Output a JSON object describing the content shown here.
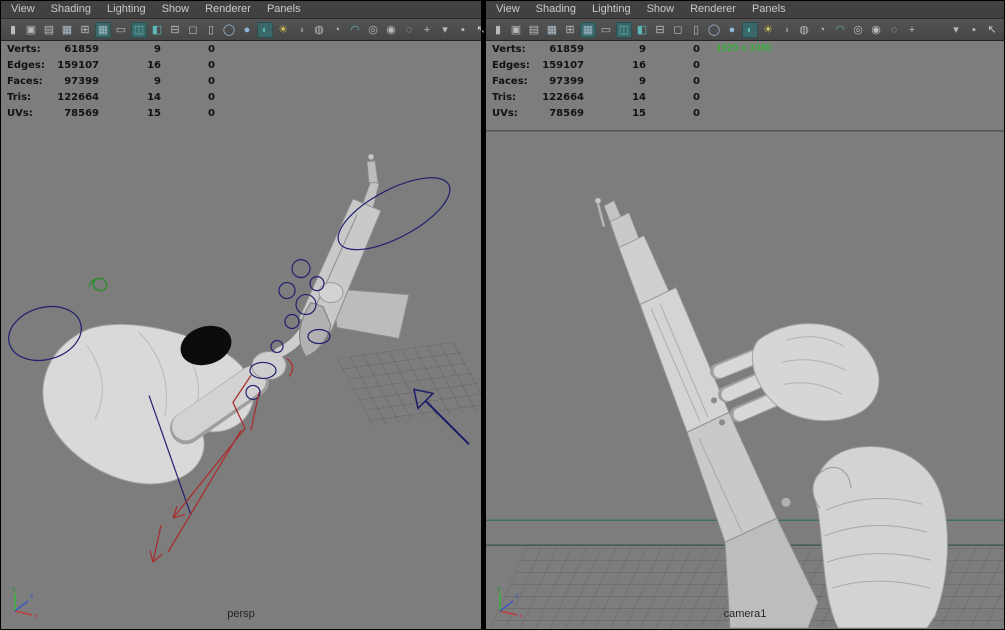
{
  "colors": {
    "viewport_bg": "#7d7d7d",
    "menubar_bg": "#414141",
    "toolbar_bg": "#4c4c4c",
    "menu_text": "#c9c9c9",
    "hud_text": "#121212",
    "resolution_gate_green": "#3fae3f",
    "selection_curve_blue": "#20206e",
    "skeleton_red": "#a83030",
    "axis_x_red": "#c23b3b",
    "axis_y_green": "#3ab53a",
    "axis_z_blue": "#3b59c2"
  },
  "menu": {
    "items": [
      "View",
      "Shading",
      "Lighting",
      "Show",
      "Renderer",
      "Panels"
    ]
  },
  "stats": {
    "rows": [
      {
        "label": "Verts:",
        "total": "61859",
        "selected": "9",
        "other": "0"
      },
      {
        "label": "Edges:",
        "total": "159107",
        "selected": "16",
        "other": "0"
      },
      {
        "label": "Faces:",
        "total": "97399",
        "selected": "9",
        "other": "0"
      },
      {
        "label": "Tris:",
        "total": "122664",
        "selected": "14",
        "other": "0"
      },
      {
        "label": "UVs:",
        "total": "78569",
        "selected": "15",
        "other": "0"
      }
    ]
  },
  "toolbar": {
    "main": [
      {
        "name": "select-camera-icon",
        "glyph": "▮",
        "color": "#b9b9b9"
      },
      {
        "name": "lock-camera-icon",
        "glyph": "▣",
        "color": "#b9b9b9"
      },
      {
        "name": "camera-bookmark-icon",
        "glyph": "▤",
        "color": "#b9b9b9"
      },
      {
        "name": "image-plane-icon",
        "glyph": "▦",
        "color": "#aebfcc"
      },
      {
        "name": "pan-zoom-icon",
        "glyph": "⊞",
        "color": "#b9b9b9"
      },
      {
        "name": "grid-icon",
        "glyph": "▦",
        "color": "#9fb9c9",
        "active": true
      },
      {
        "name": "film-gate-icon",
        "glyph": "▭",
        "color": "#b9b9b9"
      },
      {
        "name": "resolution-gate-icon",
        "glyph": "◫",
        "color": "#5fb6b6",
        "active": true
      },
      {
        "name": "gate-mask-icon",
        "glyph": "◧",
        "color": "#5fb6b6"
      },
      {
        "name": "field-chart-icon",
        "glyph": "⊟",
        "color": "#b9b9b9"
      },
      {
        "name": "safe-action-icon",
        "glyph": "◻",
        "color": "#b9b9b9"
      },
      {
        "name": "safe-title-icon",
        "glyph": "▯",
        "color": "#b9b9b9"
      },
      {
        "name": "wireframe-icon",
        "glyph": "◯",
        "color": "#9fb9d9"
      },
      {
        "name": "smooth-shade-icon",
        "glyph": "●",
        "color": "#8fb4d8"
      },
      {
        "name": "textured-icon",
        "glyph": "◐",
        "color": "#5fb6b6",
        "active": true
      },
      {
        "name": "lights-icon",
        "glyph": "☀",
        "color": "#ddc94f"
      },
      {
        "name": "shadows-icon",
        "glyph": "◑",
        "color": "#8a8a8a"
      },
      {
        "name": "ambient-occlusion-icon",
        "glyph": "◍",
        "color": "#b9b9b9"
      },
      {
        "name": "motion-blur-icon",
        "glyph": "◔",
        "color": "#b9b9b9"
      },
      {
        "name": "anti-alias-icon",
        "glyph": "◠",
        "color": "#5fb6b6"
      },
      {
        "name": "depth-of-field-icon",
        "glyph": "◎",
        "color": "#b9b9b9"
      },
      {
        "name": "isolate-select-icon",
        "glyph": "◉",
        "color": "#b9b9b9"
      },
      {
        "name": "xray-icon",
        "glyph": "◌",
        "color": "#9fc4d4"
      },
      {
        "name": "xray-joints-icon",
        "glyph": "+",
        "color": "#b9b9b9"
      }
    ],
    "right": [
      {
        "name": "snap-menu-icon",
        "glyph": "▾",
        "color": "#b9b9b9"
      },
      {
        "name": "highlight-icon",
        "glyph": "▪",
        "color": "#b9b9b9"
      },
      {
        "name": "cursor-icon",
        "glyph": "↖",
        "color": "#cccccc"
      }
    ]
  },
  "panels": [
    {
      "camera_label": "persp"
    },
    {
      "camera_label": "camera1",
      "resolution_text": "1920 x 1080"
    }
  ],
  "gizmo": {
    "x": "x",
    "y": "y",
    "z": "z"
  }
}
